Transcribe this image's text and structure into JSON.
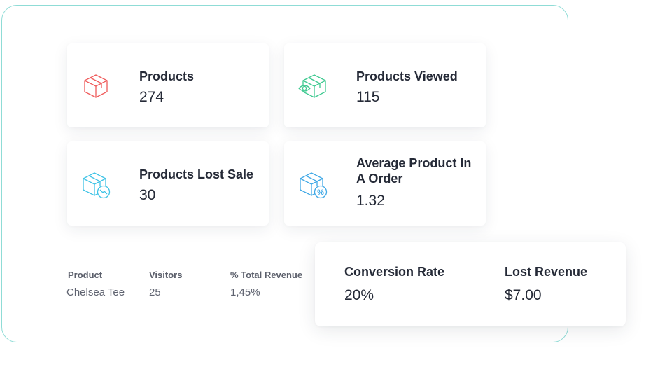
{
  "colors": {
    "panel_border": "#8fdcd6",
    "icon_products": "#ef5b5b",
    "icon_viewed": "#3ec990",
    "icon_lost": "#3fc3e6",
    "icon_average": "#3fa8e6"
  },
  "cards": [
    {
      "label": "Products",
      "value": "274",
      "icon": "box-icon"
    },
    {
      "label": "Products Viewed",
      "value": "115",
      "icon": "box-eye-icon"
    },
    {
      "label": "Products Lost Sale",
      "value": "30",
      "icon": "box-trend-down-icon"
    },
    {
      "label": "Average Product In A Order",
      "value": "1.32",
      "icon": "box-percent-icon"
    }
  ],
  "table": {
    "headers": [
      "Product",
      "Visitors",
      "% Total Revenue"
    ],
    "rows": [
      [
        "Chelsea Tee",
        "25",
        "1,45%"
      ]
    ]
  },
  "summary": {
    "conversion_label": "Conversion Rate",
    "conversion_value": "20%",
    "lost_label": "Lost Revenue",
    "lost_value": "$7.00"
  }
}
